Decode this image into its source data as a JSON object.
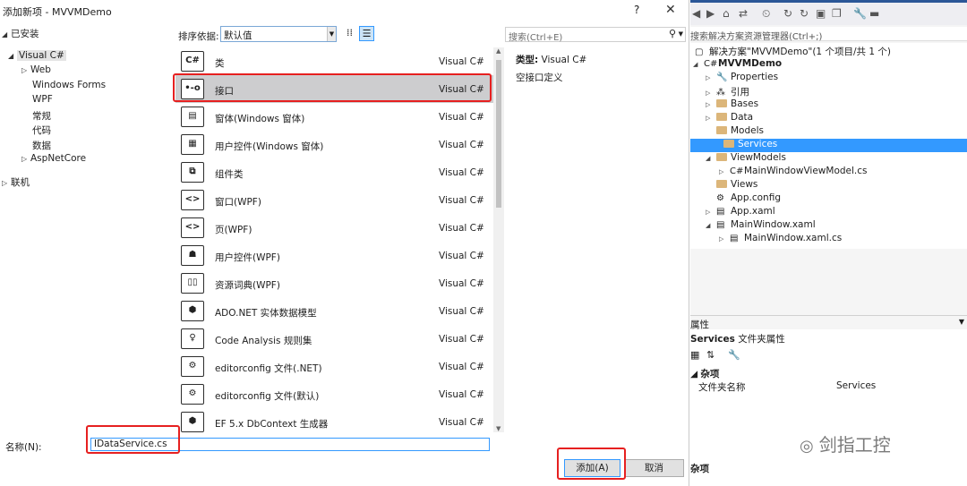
{
  "dialog": {
    "title": "添加新项 - MVVMDemo",
    "help": "?",
    "close": "✕",
    "tree": {
      "installed": "已安装",
      "visual_csharp": "Visual C#",
      "web": "Web",
      "windows_forms": "Windows Forms",
      "wpf": "WPF",
      "conventional": "常规",
      "code": "代码",
      "data": "数据",
      "aspnetcore": "AspNetCore",
      "online": "联机"
    },
    "sort_label": "排序依据:",
    "sort_value": "默认值",
    "search_placeholder": "搜索(Ctrl+E)",
    "templates": [
      {
        "name": "类",
        "lang": "Visual C#",
        "icon": "class-icon"
      },
      {
        "name": "接口",
        "lang": "Visual C#",
        "icon": "interface-icon"
      },
      {
        "name": "窗体(Windows 窗体)",
        "lang": "Visual C#",
        "icon": "form-icon"
      },
      {
        "name": "用户控件(Windows 窗体)",
        "lang": "Visual C#",
        "icon": "user-control-icon"
      },
      {
        "name": "组件类",
        "lang": "Visual C#",
        "icon": "component-icon"
      },
      {
        "name": "窗口(WPF)",
        "lang": "Visual C#",
        "icon": "window-icon"
      },
      {
        "name": "页(WPF)",
        "lang": "Visual C#",
        "icon": "page-icon"
      },
      {
        "name": "用户控件(WPF)",
        "lang": "Visual C#",
        "icon": "user-control-icon"
      },
      {
        "name": "资源词典(WPF)",
        "lang": "Visual C#",
        "icon": "dictionary-icon"
      },
      {
        "name": "ADO.NET 实体数据模型",
        "lang": "Visual C#",
        "icon": "entity-model-icon"
      },
      {
        "name": "Code Analysis 规则集",
        "lang": "Visual C#",
        "icon": "ruleset-icon"
      },
      {
        "name": "editorconfig 文件(.NET)",
        "lang": "Visual C#",
        "icon": "editorconfig-icon"
      },
      {
        "name": "editorconfig 文件(默认)",
        "lang": "Visual C#",
        "icon": "editorconfig-icon"
      },
      {
        "name": "EF 5.x DbContext 生成器",
        "lang": "Visual C#",
        "icon": "generator-icon"
      }
    ],
    "detail_type_label": "类型:",
    "detail_type_value": "Visual C#",
    "detail_desc": "空接口定义",
    "name_label": "名称(N):",
    "name_value": "IDataService.cs",
    "add_button": "添加(A)",
    "cancel_button": "取消"
  },
  "solution": {
    "search_placeholder": "搜索解决方案资源管理器(Ctrl+;)",
    "solution_label": "解决方案\"MVVMDemo\"(1 个项目/共 1 个)",
    "project": "MVVMDemo",
    "items": {
      "properties": "Properties",
      "references": "引用",
      "bases": "Bases",
      "data": "Data",
      "models": "Models",
      "services": "Services",
      "viewmodels": "ViewModels",
      "mainwindowviewmodel": "MainWindowViewModel.cs",
      "views": "Views",
      "appconfig": "App.config",
      "appxaml": "App.xaml",
      "mainwindowxaml": "MainWindow.xaml",
      "mainwindowxamlcs": "MainWindow.xaml.cs"
    }
  },
  "properties": {
    "header": "属性",
    "object_name": "Services",
    "object_type": "文件夹属性",
    "category": "杂项",
    "row_key": "文件夹名称",
    "row_value": "Services",
    "desc_title": "杂项"
  },
  "watermark": "剑指工控"
}
